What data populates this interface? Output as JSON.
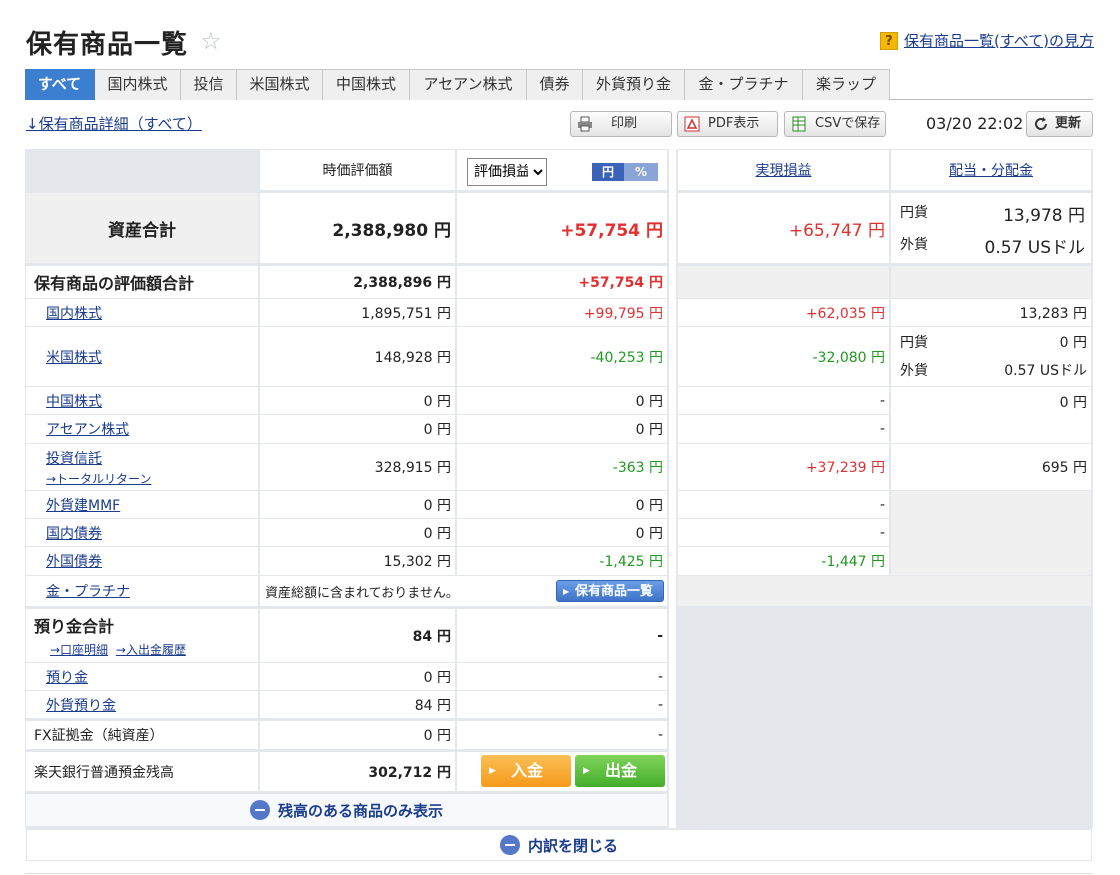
{
  "page": {
    "title": "保有商品一覧",
    "help_link": "保有商品一覧(すべて)の見方",
    "detail_link": "↓保有商品詳細（すべて）",
    "timestamp": "03/20 22:02"
  },
  "tabs": [
    "すべて",
    "国内株式",
    "投信",
    "米国株式",
    "中国株式",
    "アセアン株式",
    "債券",
    "外貨預り金",
    "金・プラチナ",
    "楽ラップ"
  ],
  "toolbar": {
    "print": "印刷",
    "pdf": "PDF表示",
    "csv": "CSVで保存",
    "refresh": "更新"
  },
  "table_header": {
    "market_value": "時価評価額",
    "pl_select": "評価損益",
    "unit_yen": "円",
    "unit_pct": "%",
    "realized": "実現損益",
    "dividends": "配当・分配金"
  },
  "total_assets": {
    "label": "資産合計",
    "value": "2,388,980 円",
    "pl": "+57,754 円",
    "realized": "+65,747 円",
    "div_yen_label": "円貨",
    "div_yen": "13,978 円",
    "div_fx_label": "外貨",
    "div_fx": "0.57 USドル"
  },
  "holdings_total": {
    "label": "保有商品の評価額合計",
    "value": "2,388,896 円",
    "pl": "+57,754 円"
  },
  "rows": {
    "domestic": {
      "label": "国内株式",
      "value": "1,895,751 円",
      "pl": "+99,795 円",
      "realized": "+62,035 円",
      "div": "13,283 円"
    },
    "us": {
      "label": "米国株式",
      "value": "148,928 円",
      "pl": "-40,253 円",
      "realized": "-32,080 円",
      "div_yen_label": "円貨",
      "div_yen": "0 円",
      "div_fx_label": "外貨",
      "div_fx": "0.57 USドル"
    },
    "china": {
      "label": "中国株式",
      "value": "0 円",
      "pl": "0 円",
      "realized": "-"
    },
    "asean": {
      "label": "アセアン株式",
      "value": "0 円",
      "pl": "0 円",
      "realized": "-",
      "div": "0 円"
    },
    "fund": {
      "label": "投資信託",
      "sub": "→トータルリターン",
      "value": "328,915 円",
      "pl": "-363 円",
      "realized": "+37,239 円",
      "div": "695 円"
    },
    "mmf": {
      "label": "外貨建MMF",
      "value": "0 円",
      "pl": "0 円",
      "realized": "-"
    },
    "jbond": {
      "label": "国内債券",
      "value": "0 円",
      "pl": "0 円",
      "realized": "-"
    },
    "fbond": {
      "label": "外国債券",
      "value": "15,302 円",
      "pl": "-1,425 円",
      "realized": "-1,447 円"
    },
    "gold": {
      "label": "金・プラチナ",
      "note": "資産総額に含まれておりません。",
      "button": "保有商品一覧"
    }
  },
  "deposits": {
    "label": "預り金合計",
    "link1": "→口座明細",
    "link2": "→入出金履歴",
    "value": "84 円",
    "pl": "-",
    "yen_label": "預り金",
    "yen_value": "0 円",
    "yen_pl": "-",
    "fx_label": "外貨預り金",
    "fx_value": "84 円",
    "fx_pl": "-"
  },
  "fx": {
    "label": "FX証拠金（純資産）",
    "value": "0 円",
    "pl": "-"
  },
  "bank": {
    "label": "楽天銀行普通預金残高",
    "value": "302,712 円",
    "deposit": "入金",
    "withdraw": "出金"
  },
  "toggles": {
    "balance_only": "残高のある商品のみ表示",
    "close": "内訳を閉じる"
  },
  "colors": {
    "positive": "#e03030",
    "negative": "#1f9a1f",
    "tab_active": "#3c7fd0"
  }
}
